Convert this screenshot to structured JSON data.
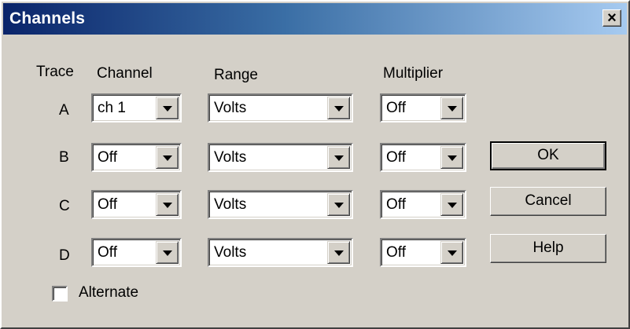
{
  "window": {
    "title": "Channels",
    "close_glyph": "×"
  },
  "headers": {
    "trace": "Trace",
    "channel": "Channel",
    "range": "Range",
    "multiplier": "Multiplier"
  },
  "rows": [
    {
      "trace": "A",
      "channel": "ch 1",
      "range": "Volts",
      "multiplier": "Off"
    },
    {
      "trace": "B",
      "channel": "Off",
      "range": "Volts",
      "multiplier": "Off"
    },
    {
      "trace": "C",
      "channel": "Off",
      "range": "Volts",
      "multiplier": "Off"
    },
    {
      "trace": "D",
      "channel": "Off",
      "range": "Volts",
      "multiplier": "Off"
    }
  ],
  "buttons": {
    "ok": "OK",
    "cancel": "Cancel",
    "help": "Help"
  },
  "alternate": {
    "label": "Alternate",
    "checked": false
  },
  "colors": {
    "face": "#d4d0c8",
    "title_start": "#0a246a",
    "title_end": "#a6caf0"
  },
  "icons": {
    "close": "close-icon",
    "dropdown": "chevron-down-icon"
  }
}
